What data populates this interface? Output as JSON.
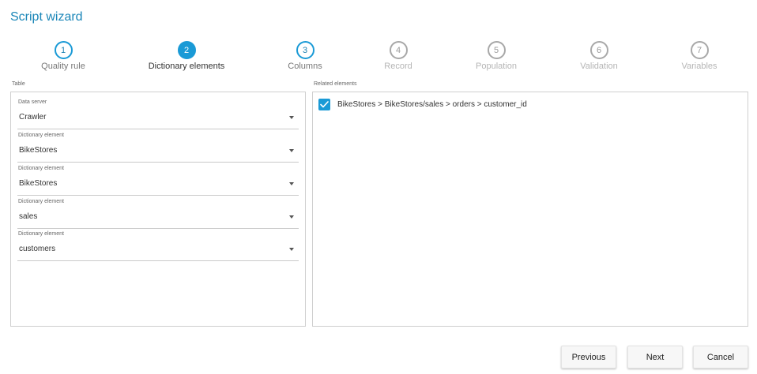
{
  "header": {
    "title": "Script wizard"
  },
  "steps": [
    {
      "number": "1",
      "label": "Quality rule",
      "state": "done"
    },
    {
      "number": "2",
      "label": "Dictionary elements",
      "state": "active"
    },
    {
      "number": "3",
      "label": "Columns",
      "state": "done"
    },
    {
      "number": "4",
      "label": "Record",
      "state": "pending"
    },
    {
      "number": "5",
      "label": "Population",
      "state": "pending"
    },
    {
      "number": "6",
      "label": "Validation",
      "state": "pending"
    },
    {
      "number": "7",
      "label": "Variables",
      "state": "pending"
    }
  ],
  "table_panel": {
    "section_label": "Table",
    "fields": [
      {
        "label": "Data server",
        "value": "Crawler"
      },
      {
        "label": "Dictionary element",
        "value": "BikeStores"
      },
      {
        "label": "Dictionary element",
        "value": "BikeStores"
      },
      {
        "label": "Dictionary element",
        "value": "sales"
      },
      {
        "label": "Dictionary element",
        "value": "customers"
      }
    ]
  },
  "related_panel": {
    "section_label": "Related elements",
    "items": [
      {
        "text": "BikeStores > BikeStores/sales > orders > customer_id",
        "checked": true
      }
    ]
  },
  "footer": {
    "previous_label": "Previous",
    "next_label": "Next",
    "cancel_label": "Cancel"
  },
  "colors": {
    "accent": "#1a9ad6",
    "title": "#1a86b8",
    "inactive": "#b5b5b5"
  },
  "icons": {
    "checkbox": "check-icon",
    "dropdown": "chevron-down-icon"
  }
}
